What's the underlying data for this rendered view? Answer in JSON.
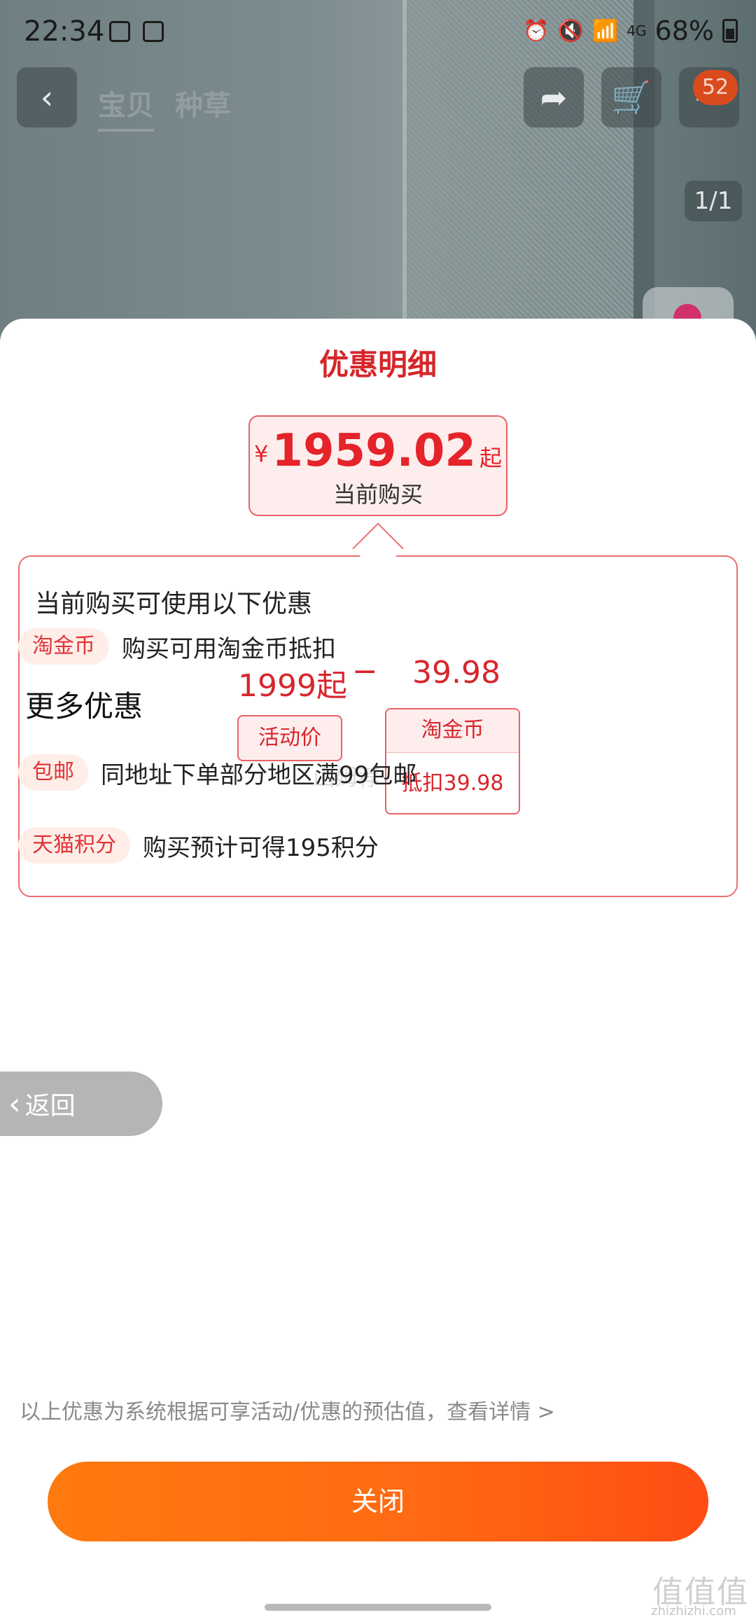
{
  "status_bar": {
    "time": "22:34",
    "network": "4G",
    "battery": "68%"
  },
  "top_nav": {
    "tabs": [
      "宝贝",
      "种草"
    ],
    "cart_badge": "52"
  },
  "photo": {
    "counter": "1/1"
  },
  "sheet": {
    "title": "优惠明细",
    "price": {
      "currency": "¥",
      "amount": "1959.02",
      "suffix": "起",
      "label": "当前购买"
    },
    "detail": {
      "heading": "当前购买可使用以下优惠",
      "base_price": "1999起",
      "minus": "−",
      "coin_amount": "39.98",
      "base_tag": "活动价",
      "coin_tag_title": "淘金币",
      "coin_tag_value": "抵扣39.98",
      "watermark": "山姆荐"
    },
    "coin_row": {
      "badge": "淘金币",
      "text": "购买可用淘金币抵扣"
    },
    "more_title": "更多优惠",
    "shipping_row": {
      "badge": "包邮",
      "text": "同地址下单部分地区满99包邮"
    },
    "points_row": {
      "badge": "天猫积分",
      "text": "购买预计可得195积分"
    },
    "footnote": "以上优惠为系统根据可享活动/优惠的预估值，查看详情 >",
    "close_label": "关闭"
  },
  "back_pill": {
    "label": "返回"
  },
  "corner": {
    "logo": "值值值",
    "url": "zhizhizhi.com"
  },
  "colors": {
    "accent_red": "#d6262b",
    "button_orange": "#ff6a12"
  }
}
